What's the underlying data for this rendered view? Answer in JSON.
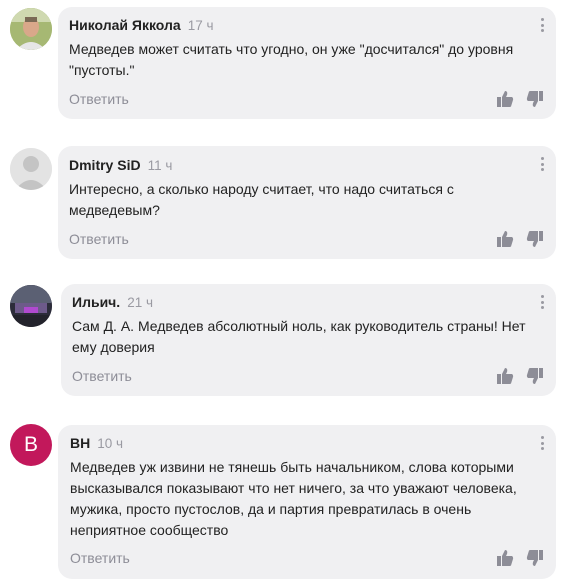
{
  "comments": [
    {
      "author": "Николай Яккола",
      "time": "17 ч",
      "text_lines": [
        "Медведев может считать что угодно, он уже \"досчитался\" до уровня",
        "\"пустоты.\""
      ],
      "reply_label": "Ответить",
      "avatar": "photo"
    },
    {
      "author": "Dmitry SiD",
      "time": "11 ч",
      "text_lines": [
        "Интересно, а сколько народу считает, что надо считаться с",
        "медведевым?"
      ],
      "reply_label": "Ответить",
      "avatar": "placeholder"
    },
    {
      "author": "Ильич.",
      "time": "21 ч",
      "text_lines": [
        "Сам Д. А. Медведев абсолютный ноль, как руководитель страны! Нет",
        "ему доверия"
      ],
      "reply_label": "Ответить",
      "avatar": "photo"
    },
    {
      "author": "ВН",
      "time": "10 ч",
      "avatar_letter": "В",
      "text_lines": [
        "Медведев уж извини не тянешь быть начальником, слова которыми",
        "высказывался показывают что нет ничего, за что уважают человека,",
        "мужика, просто пустослов, да и партия превратилась в очень",
        "неприятное сообщество"
      ],
      "reply_label": "Ответить",
      "avatar": "letter"
    }
  ],
  "colors": {
    "bubble": "#f0f0f2",
    "meta": "#9a9aa2",
    "letter_avatar": "#c2185b"
  }
}
